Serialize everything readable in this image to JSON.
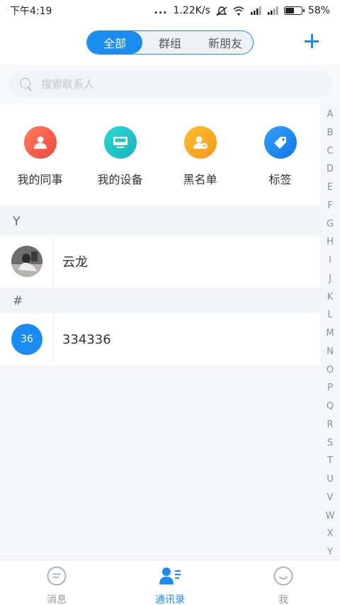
{
  "status_bar": {
    "time": "下午4:19",
    "dots": "...",
    "speed": "1.22K/s",
    "battery": "58%",
    "battery_level": 0.58
  },
  "header": {
    "tabs": [
      {
        "label": "全部",
        "active": true
      },
      {
        "label": "群组",
        "active": false
      },
      {
        "label": "新朋友",
        "active": false
      }
    ],
    "add_icon": "plus-icon"
  },
  "search": {
    "placeholder": "搜索联系人",
    "value": ""
  },
  "quick_entries": [
    {
      "label": "我的同事",
      "icon": "colleague-icon",
      "color": "#f4624e"
    },
    {
      "label": "我的设备",
      "icon": "monitor-icon",
      "color": "#1ec6c2"
    },
    {
      "label": "黑名单",
      "icon": "blocked-user-icon",
      "color": "#f5a623"
    },
    {
      "label": "标签",
      "icon": "tag-icon",
      "color": "#1d8ff0"
    }
  ],
  "sections": [
    {
      "header": "Y",
      "contacts": [
        {
          "name": "云龙",
          "avatar": "photo"
        }
      ]
    },
    {
      "header": "#",
      "contacts": [
        {
          "name": "334336",
          "avatar_text": "36",
          "avatar_color": "#1a8cf0"
        }
      ]
    }
  ],
  "index_letters": [
    "A",
    "B",
    "C",
    "D",
    "E",
    "F",
    "G",
    "H",
    "I",
    "J",
    "K",
    "L",
    "M",
    "N",
    "O",
    "P",
    "Q",
    "R",
    "S",
    "T",
    "U",
    "V",
    "W",
    "X",
    "Y"
  ],
  "tabbar": {
    "items": [
      {
        "label": "消息",
        "icon": "message-icon",
        "active": false
      },
      {
        "label": "通讯录",
        "icon": "contacts-icon",
        "active": true
      },
      {
        "label": "我",
        "icon": "smile-icon",
        "active": false
      }
    ]
  },
  "colors": {
    "accent": "#1a8cf0",
    "background": "#f4f6f9"
  }
}
